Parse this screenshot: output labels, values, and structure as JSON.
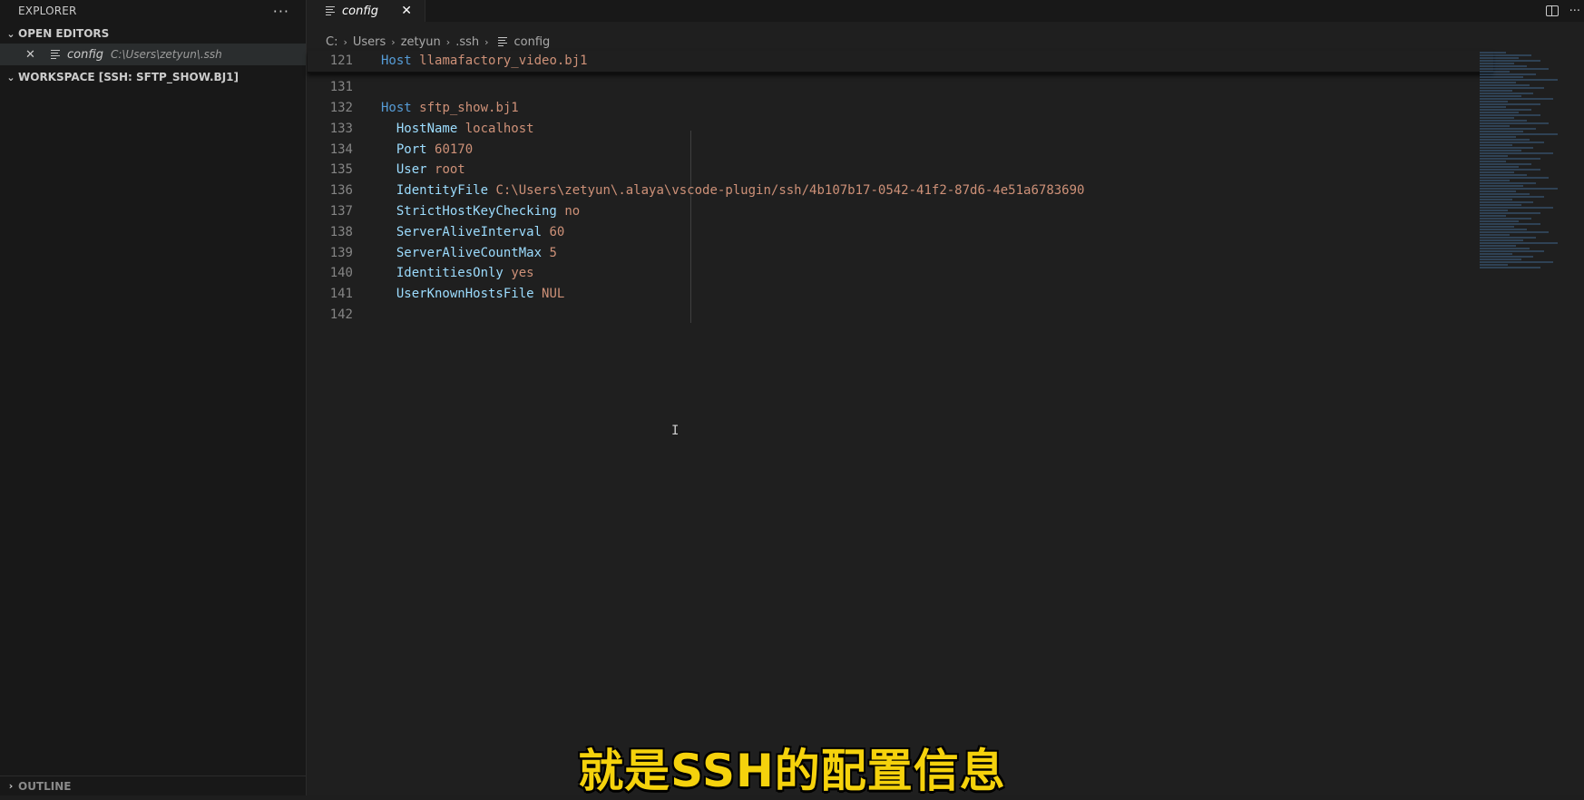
{
  "sidebar": {
    "title": "EXPLORER",
    "more": "···",
    "open_editors": {
      "label": "OPEN EDITORS",
      "items": [
        {
          "close": "✕",
          "name": "config",
          "path": "C:\\Users\\zetyun\\.ssh"
        }
      ]
    },
    "workspace": {
      "label": "WORKSPACE [SSH: SFTP_SHOW.BJ1]"
    },
    "outline": {
      "label": "OUTLINE"
    }
  },
  "tab": {
    "label": "config",
    "close": "✕"
  },
  "tab_actions": {
    "more": "···"
  },
  "breadcrumb": [
    "C:",
    "Users",
    "zetyun",
    ".ssh",
    "config"
  ],
  "code": {
    "sticky": {
      "num": "121",
      "key": "Host",
      "value": "llamafactory_video.bj1"
    },
    "lines": [
      {
        "num": "131",
        "key": "",
        "value": ""
      },
      {
        "num": "132",
        "key": "Host",
        "value": "sftp_show.bj1"
      },
      {
        "num": "133",
        "key": "HostName",
        "value": "localhost"
      },
      {
        "num": "134",
        "key": "Port",
        "value": "60170"
      },
      {
        "num": "135",
        "key": "User",
        "value": "root"
      },
      {
        "num": "136",
        "key": "IdentityFile",
        "value": "C:\\Users\\zetyun\\.alaya\\vscode-plugin/ssh/4b107b17-0542-41f2-87d6-4e51a6783690"
      },
      {
        "num": "137",
        "key": "StrictHostKeyChecking",
        "value": "no"
      },
      {
        "num": "138",
        "key": "ServerAliveInterval",
        "value": "60"
      },
      {
        "num": "139",
        "key": "ServerAliveCountMax",
        "value": "5"
      },
      {
        "num": "140",
        "key": "IdentitiesOnly",
        "value": "yes"
      },
      {
        "num": "141",
        "key": "UserKnownHostsFile",
        "value": "NUL"
      },
      {
        "num": "142",
        "key": "",
        "value": ""
      }
    ]
  },
  "mouse_cursor": "I",
  "subtitle": "就是SSH的配置信息",
  "colors": {
    "keyword": "#9cdcfe",
    "host_keyword": "#569cd6",
    "value": "#ce9178",
    "subtitle": "#f5d20c"
  }
}
